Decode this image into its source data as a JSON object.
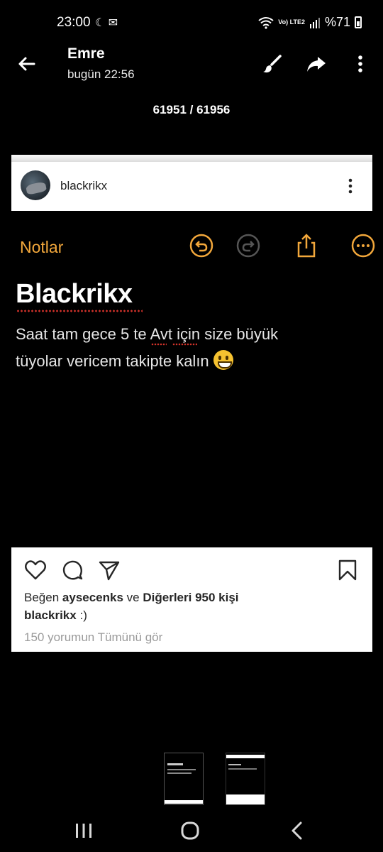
{
  "status_bar": {
    "time": "23:00",
    "left_icons": "☾ ✉",
    "network": "Vo) LTE2",
    "battery_label": "%71"
  },
  "header": {
    "contact_name": "Emre",
    "timestamp": "bugün 22:56",
    "counter": "61951 / 61956"
  },
  "post": {
    "username": "blackrikx",
    "likes_prefix": "Beğen",
    "likes_user": "aysecenks",
    "likes_mid": "ve",
    "likes_others": "Diğerleri 950 kişi",
    "caption_user": "blackrikx",
    "caption_text": ":)",
    "view_comments": "150 yorumun Tümünü gör"
  },
  "note": {
    "back_label": "Notlar",
    "title": "Blackrikx",
    "line1": "Saat tam gece 5 te Avt için size büyük",
    "line2": "tüyolar vericem takipte kalın"
  },
  "colors": {
    "notes_accent": "#f2a73b",
    "spell_error": "#d0322a"
  },
  "icons": [
    "back-arrow-icon",
    "brush-icon",
    "share-arrow-icon",
    "more-vert-icon",
    "undo-icon",
    "redo-icon",
    "share-icon",
    "more-circle-icon",
    "heart-icon",
    "comment-icon",
    "send-icon",
    "bookmark-icon",
    "recents-icon",
    "home-icon",
    "nav-back-icon"
  ]
}
